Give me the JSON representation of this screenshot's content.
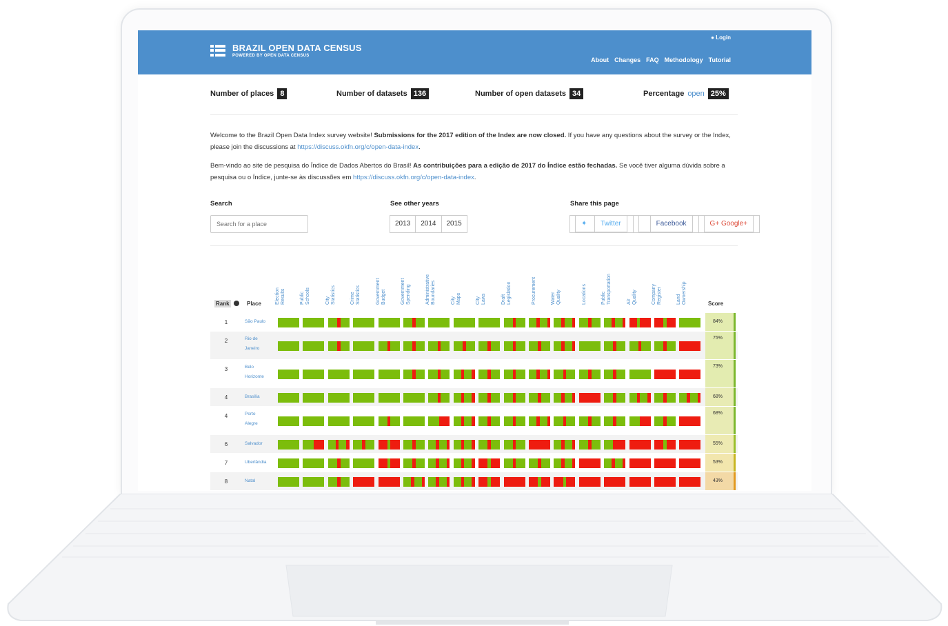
{
  "header": {
    "title": "BRAZIL OPEN DATA CENSUS",
    "subtitle": "POWERED BY OPEN DATA CENSUS",
    "login": "Login",
    "nav": [
      "About",
      "Changes",
      "FAQ",
      "Methodology",
      "Tutorial"
    ]
  },
  "stats": {
    "places_label": "Number of places",
    "places_value": "8",
    "datasets_label": "Number of datasets",
    "datasets_value": "136",
    "open_label": "Number of open datasets",
    "open_value": "34",
    "pct_label": "Percentage",
    "pct_word": "open",
    "pct_value": "25%"
  },
  "intro": {
    "en_1": "Welcome to the Brazil Open Data Index survey website! ",
    "en_bold": "Submissions for the 2017 edition of the Index are now closed.",
    "en_2": " If you have any questions about the survey or the Index, please join the discussions at ",
    "en_link": "https://discuss.okfn.org/c/open-data-index",
    "en_3": ".",
    "pt_1": "Bem-vindo ao site de pesquisa do Índice de Dados Abertos do Brasil! ",
    "pt_bold": "As contribuições para a edição de 2017 do Índice estão fechadas.",
    "pt_2": " Se você tiver alguma dúvida sobre a pesquisa ou o Índice, junte-se às discussões em ",
    "pt_link": "https://discuss.okfn.org/c/open-data-index",
    "pt_3": "."
  },
  "controls": {
    "search_label": "Search",
    "search_placeholder": "Search for a place",
    "years_label": "See other years",
    "years": [
      "2013",
      "2014",
      "2015"
    ],
    "share_label": "Share this page",
    "share": [
      "Twitter",
      "Facebook",
      "G+ Google+"
    ]
  },
  "table": {
    "rank_header": "Rank",
    "place_header": "Place",
    "score_header": "Score",
    "columns": [
      "Election\nResults",
      "Public\nSchools",
      "City\nStatistics",
      "Crime\nStatistics",
      "Government\nBudget",
      "Government\nSpending",
      "Administrative\nBoundaries",
      "City\nMaps",
      "City\nLaws",
      "Draft\nLegislation",
      "Procurement",
      "Water\nQuality",
      "Locations",
      "Public\nTransportation",
      "Air\nQuality",
      "Company\nRegister",
      "Land\nOwnership"
    ],
    "rows": [
      {
        "rank": "1",
        "place": "São Paulo",
        "score": "84%",
        "score_color": "#e3ecb0",
        "bar": "#7cb82f",
        "cells": [
          "G",
          "G",
          "GRG",
          "G",
          "G",
          "GRG",
          "G",
          "G",
          "G",
          "GRG",
          "GRGR",
          "GRGR",
          "GRG",
          "GRGR",
          "RGRR",
          "RGR",
          "G"
        ]
      },
      {
        "rank": "2",
        "place": "Rio de\nJaneiro",
        "score": "75%",
        "score_color": "#e3ecb0",
        "bar": "#7cb82f",
        "cells": [
          "G",
          "G",
          "GRG",
          "G",
          "GRG",
          "GRG",
          "GRG",
          "GRG",
          "GRG",
          "GRG",
          "GRG",
          "GRGR",
          "G",
          "GRG",
          "GRG",
          "GRG",
          "R"
        ]
      },
      {
        "rank": "3",
        "place": "Belo\nHorizonte",
        "score": "73%",
        "score_color": "#e3ecb0",
        "bar": "#7cb82f",
        "cells": [
          "G",
          "G",
          "G",
          "G",
          "G",
          "GRG",
          "GRG",
          "GRGR",
          "GRG",
          "GRG",
          "GRGR",
          "GRG",
          "GRG",
          "GRG",
          "G",
          "R",
          "R"
        ]
      },
      {
        "rank": "4",
        "place": "Brasília",
        "score": "68%",
        "score_color": "#e8ebb4",
        "bar": "#7cb82f",
        "cells": [
          "G",
          "G",
          "G",
          "G",
          "G",
          "G",
          "GRG",
          "GRGR",
          "GRG",
          "GRG",
          "GRG",
          "GRGR",
          "R",
          "GRG",
          "GRGR",
          "GRG",
          "GRGR"
        ]
      },
      {
        "rank": "4",
        "place": "Porto\nAlegre",
        "score": "68%",
        "score_color": "#e8ebb4",
        "bar": "#7cb82f",
        "cells": [
          "G",
          "G",
          "G",
          "G",
          "GRG",
          "G",
          "GR",
          "GRGR",
          "GRG",
          "GRG",
          "GRGR",
          "GRG",
          "GRG",
          "GRG",
          "GR",
          "GRG",
          "R"
        ]
      },
      {
        "rank": "6",
        "place": "Salvador",
        "score": "55%",
        "score_color": "#eeeab2",
        "bar": "#9bbf2c",
        "cells": [
          "G",
          "GR",
          "GRGR",
          "GRG",
          "RGR",
          "GRG",
          "GRGR",
          "GRGR",
          "GRG",
          "GRG",
          "R",
          "GRGR",
          "GRG",
          "GRR",
          "R",
          "RGR",
          "R"
        ]
      },
      {
        "rank": "7",
        "place": "Uberlândia",
        "score": "53%",
        "score_color": "#f2e6ad",
        "bar": "#c8b623",
        "cells": [
          "G",
          "G",
          "GRG",
          "G",
          "RGR",
          "GRG",
          "GRGR",
          "GRGR",
          "RGR",
          "GRG",
          "GRG",
          "GRGR",
          "R",
          "GRGR",
          "R",
          "R",
          "R"
        ]
      },
      {
        "rank": "8",
        "place": "Natal",
        "score": "43%",
        "score_color": "#f3d9a6",
        "bar": "#e29a21",
        "cells": [
          "G",
          "G",
          "GRG",
          "R",
          "R",
          "GRGR",
          "GRGR",
          "GRGR",
          "RGR",
          "R",
          "RGR",
          "RGR",
          "R",
          "R",
          "R",
          "R",
          "R"
        ]
      }
    ]
  },
  "colors": {
    "header": "#4d8fcc",
    "green": "#7cbd0c",
    "red": "#ee1c10",
    "link": "#4d8fcc"
  }
}
